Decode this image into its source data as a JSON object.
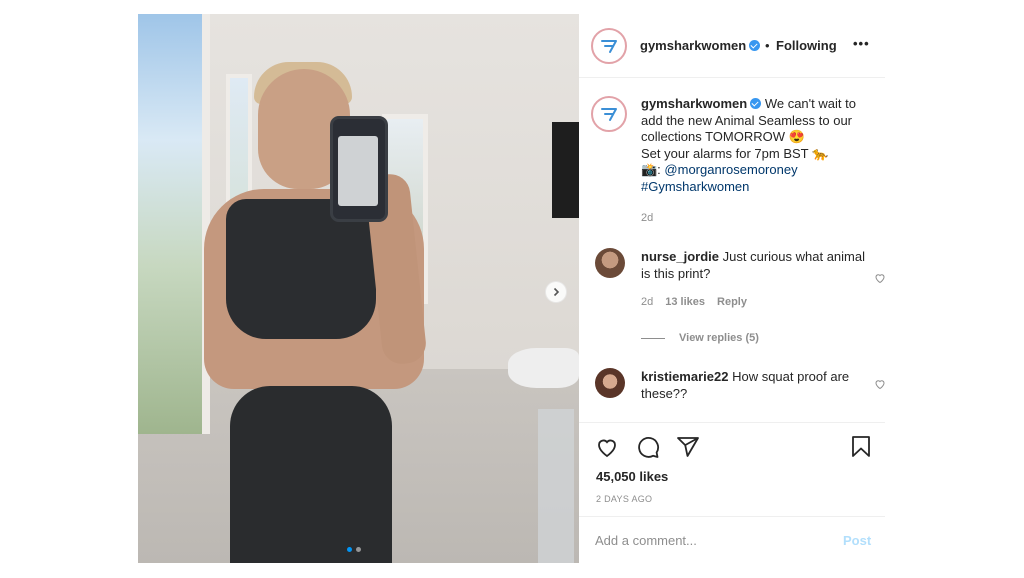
{
  "header": {
    "username": "gymsharkwomen",
    "separator": "•",
    "follow_status": "Following",
    "more_label": "•••"
  },
  "caption": {
    "username": "gymsharkwomen",
    "line1": "We can't wait to add the new Animal Seamless to our collections TOMORROW 😍",
    "line2": "Set your alarms for 7pm BST 🐆",
    "credit_prefix": "📸: ",
    "credit_mention": "@morganrosemoroney",
    "hashtag": "#Gymsharkwomen",
    "age": "2d"
  },
  "comments": [
    {
      "username": "nurse_jordie",
      "text": "Just curious what animal is this print?",
      "age": "2d",
      "likes": "13 likes",
      "reply_label": "Reply"
    },
    {
      "username": "kristiemarie22",
      "text": "How squat proof are these??"
    }
  ],
  "view_replies": "View replies (5)",
  "likes_count": "45,050 likes",
  "timestamp": "2 DAYS AGO",
  "comment_box": {
    "placeholder": "Add a comment...",
    "post_label": "Post"
  },
  "carousel": {
    "total_slides": 2,
    "active_slide": 1
  },
  "colors": {
    "link": "#00376b",
    "verified": "#3897f0",
    "post_disabled": "#b2dffc",
    "active_dot": "#0095f6"
  },
  "icons": [
    "gymshark-logo-icon",
    "verified-icon",
    "heart-icon",
    "comment-icon",
    "share-icon",
    "bookmark-icon",
    "chevron-right-icon"
  ]
}
